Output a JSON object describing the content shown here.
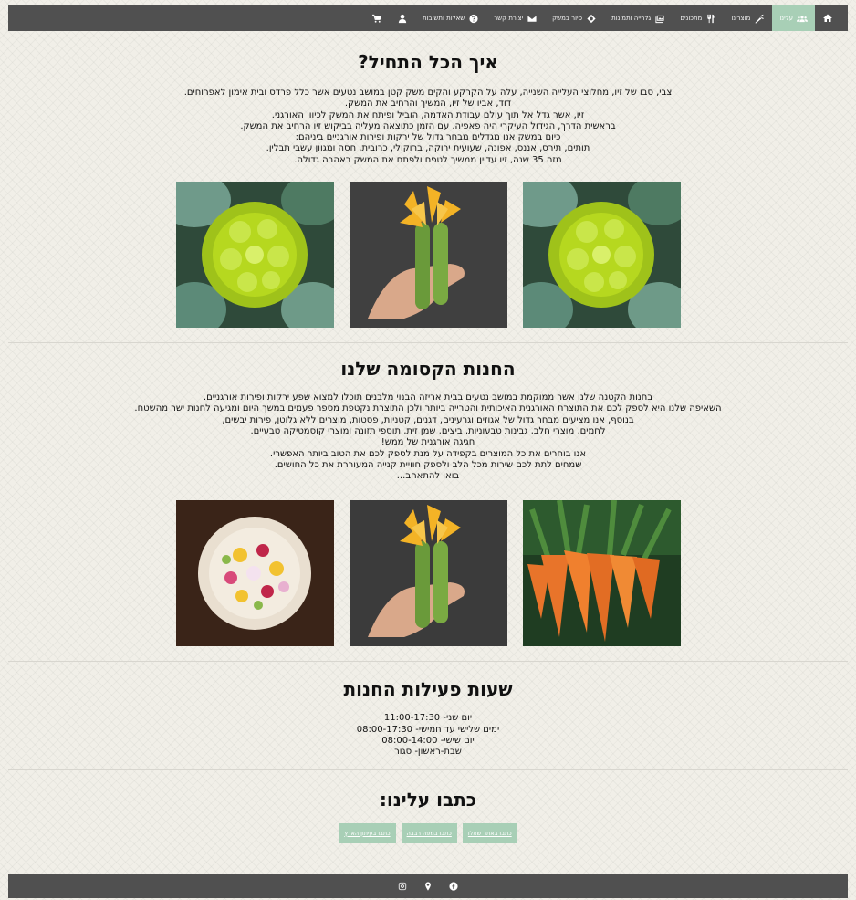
{
  "nav": {
    "home_icon": "home-icon",
    "items": [
      {
        "label": "עלינו",
        "icon": "users-icon",
        "active": true
      },
      {
        "label": "מוצרינו",
        "icon": "carrot-icon"
      },
      {
        "label": "מתכונים",
        "icon": "utensils-icon"
      },
      {
        "label": "גלרייה ותמונות",
        "icon": "photo-icon"
      },
      {
        "label": "סיור במשק",
        "icon": "tag-icon"
      },
      {
        "label": "יצירת קשר",
        "icon": "envelope-icon"
      },
      {
        "label": "שאלות ותשובות",
        "icon": "question-icon"
      }
    ],
    "user_icon": "user-icon",
    "cart_icon": "cart-icon",
    "active_color": "#a8cfb6",
    "bar_color": "#505050"
  },
  "about": {
    "title": "איך הכל התחיל?",
    "lines": [
      "צבי, סבו של זיו, מחלוצי העלייה השנייה, עלה על הקרקע והקים משק קטן במושב נטעים אשר כלל פרדס ובית אימון לאפרוחים.",
      "דוד, אביו של זיו, המשיך והרחיב את המשק.",
      "זיו, אשר גדל אל תוך עולם עבודת האדמה, הוביל ופיתח את המשק לכיוון האורגני.",
      "בראשית הדרך, הגידול העיקרי היה פאפיה. עם הזמן כתוצאה מעליה בביקוש זיו הרחיב את המשק.",
      "כיום במשק אנו מגדלים מבחר גדול של ירקות ופירות אורגניים ביניהם:",
      "תותים, תירס, אננס, אפונה, שעועית ירוקה, ברוקולי, כרובית, חסה ומגוון עשבי תבלין.",
      "מזה 35 שנה, זיו עדיין ממשיך לטפח ולפתח את המשק באהבה גדולה."
    ]
  },
  "shop": {
    "title": "החנות הקסומה שלנו",
    "lines": [
      "בחנות הקטנה שלנו אשר ממוקמת במושב נטעים בבית אריזה הבנוי מלבנים תוכלו למצוא שפע ירקות ופירות אורגניים.",
      "השאיפה שלנו היא לספק לכם את התוצרת האורגנית האיכותית והטרייה ביותר ולכן התוצרת נקטפת מספר פעמים במשך היום ומגיעה לחנות ישר מהשטח.",
      "בנוסף, אנו מציעים מבחר גדול של אגוזים וגרעינים, דגנים, קטניות, פסטות, מוצרים ללא גלוטן, פירות יבשים,",
      "לחמים, מוצרי חלב, גבינות טבעוניות, ביצים, שמן זית, תוספי תזונה ומוצרי קוסמטיקה טבעיים.",
      "חגיגה אורגנית של ממש!",
      "אנו בוחרים את כל המוצרים בקפידה על מנת לספק לכם את הטוב ביותר האפשרי.",
      "שמחים לתת לכם שירות מכל הלב ולספק חוויית קנייה המעוררת את כל החושים.",
      "בואו להתאהב..."
    ]
  },
  "hours": {
    "title": "שעות פעילות החנות",
    "lines": [
      "יום שני- 11:00-17:30",
      "ימים שלישי עד חמישי- 08:00-17:30",
      "יום שישי- 08:00-14:00",
      "שבת-ראשון- סגור"
    ]
  },
  "contact": {
    "title": "כתבו עלינו:",
    "buttons": [
      {
        "label": "כתבו באתר שאלו"
      },
      {
        "label": "כתבו במפה רבבה"
      },
      {
        "label": "כתבו בעיתון הארץ"
      }
    ]
  },
  "footer": {
    "icons": [
      "facebook-icon",
      "location-pin-icon",
      "instagram-icon"
    ]
  }
}
